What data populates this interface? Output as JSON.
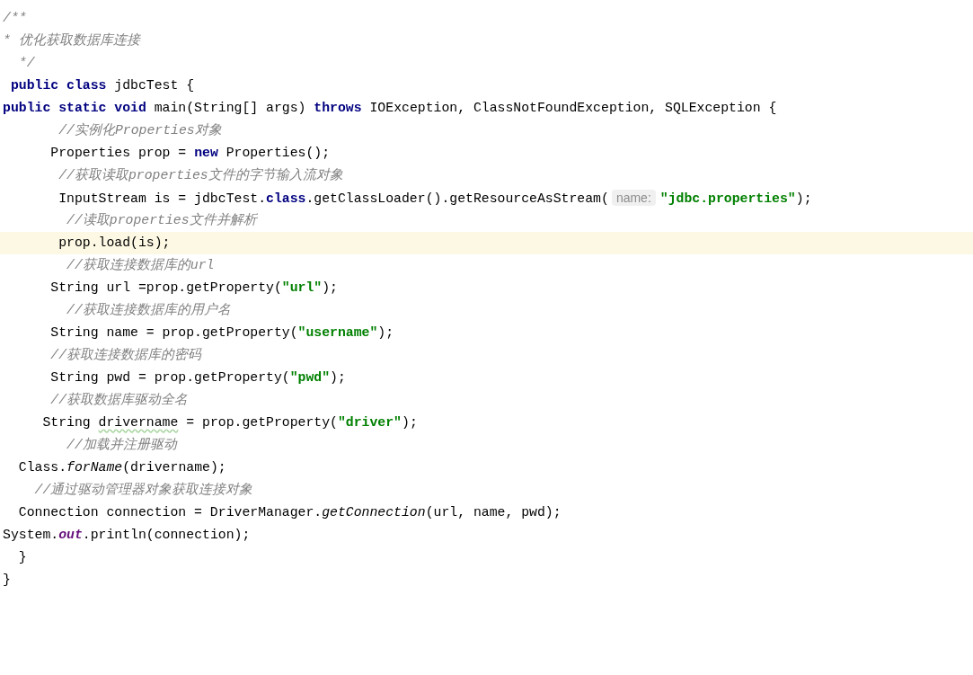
{
  "editor": {
    "lines": [
      {
        "current": false,
        "tokens": [
          {
            "kind": "comment",
            "text": "/**"
          }
        ]
      },
      {
        "current": false,
        "tokens": [
          {
            "kind": "comment",
            "text": "* 优化获取数据库连接"
          }
        ]
      },
      {
        "current": false,
        "tokens": [
          {
            "kind": "comment",
            "text": "  */"
          }
        ]
      },
      {
        "current": false,
        "tokens": [
          {
            "kind": "keyword",
            "text": " public class"
          },
          {
            "kind": "plain",
            "text": " jdbcTest {"
          }
        ]
      },
      {
        "current": false,
        "tokens": [
          {
            "kind": "keyword",
            "text": "public static void"
          },
          {
            "kind": "plain",
            "text": " main(String[] args) "
          },
          {
            "kind": "keyword",
            "text": "throws"
          },
          {
            "kind": "plain",
            "text": " IOException, ClassNotFoundException, SQLException {"
          }
        ]
      },
      {
        "current": false,
        "tokens": [
          {
            "kind": "comment",
            "text": "       //实例化Properties对象"
          }
        ]
      },
      {
        "current": false,
        "tokens": [
          {
            "kind": "plain",
            "text": "      Properties prop = "
          },
          {
            "kind": "keyword",
            "text": "new"
          },
          {
            "kind": "plain",
            "text": " Properties();"
          }
        ]
      },
      {
        "current": false,
        "tokens": [
          {
            "kind": "comment",
            "text": "       //获取读取properties文件的字节输入流对象"
          }
        ]
      },
      {
        "current": false,
        "tokens": [
          {
            "kind": "plain",
            "text": "       InputStream is = jdbcTest."
          },
          {
            "kind": "keyword",
            "text": "class"
          },
          {
            "kind": "plain",
            "text": ".getClassLoader().getResourceAsStream("
          },
          {
            "kind": "hint",
            "text": "name:"
          },
          {
            "kind": "string",
            "text": "\"jdbc.properties\""
          },
          {
            "kind": "plain",
            "text": ");"
          }
        ]
      },
      {
        "current": false,
        "tokens": [
          {
            "kind": "comment",
            "text": "        //读取properties文件并解析"
          }
        ]
      },
      {
        "current": true,
        "tokens": [
          {
            "kind": "plain",
            "text": "       prop.load(is);"
          }
        ]
      },
      {
        "current": false,
        "tokens": [
          {
            "kind": "comment",
            "text": "        //获取连接数据库的url"
          }
        ]
      },
      {
        "current": false,
        "tokens": [
          {
            "kind": "plain",
            "text": "      String url =prop.getProperty("
          },
          {
            "kind": "string",
            "text": "\"url\""
          },
          {
            "kind": "plain",
            "text": ");"
          }
        ]
      },
      {
        "current": false,
        "tokens": [
          {
            "kind": "comment",
            "text": "        //获取连接数据库的用户名"
          }
        ]
      },
      {
        "current": false,
        "tokens": [
          {
            "kind": "plain",
            "text": "      String name = prop.getProperty("
          },
          {
            "kind": "string",
            "text": "\"username\""
          },
          {
            "kind": "plain",
            "text": ");"
          }
        ]
      },
      {
        "current": false,
        "tokens": [
          {
            "kind": "comment",
            "text": "      //获取连接数据库的密码"
          }
        ]
      },
      {
        "current": false,
        "tokens": [
          {
            "kind": "plain",
            "text": "      String pwd = prop.getProperty("
          },
          {
            "kind": "string",
            "text": "\"pwd\""
          },
          {
            "kind": "plain",
            "text": ");"
          }
        ]
      },
      {
        "current": false,
        "tokens": [
          {
            "kind": "comment",
            "text": "      //获取数据库驱动全名"
          }
        ]
      },
      {
        "current": false,
        "tokens": [
          {
            "kind": "plain",
            "text": "     String "
          },
          {
            "kind": "warning",
            "text": "drivername"
          },
          {
            "kind": "plain",
            "text": " = prop.getProperty("
          },
          {
            "kind": "string",
            "text": "\"driver\""
          },
          {
            "kind": "plain",
            "text": ");"
          }
        ]
      },
      {
        "current": false,
        "tokens": [
          {
            "kind": "comment",
            "text": "        //加载并注册驱动"
          }
        ]
      },
      {
        "current": false,
        "tokens": [
          {
            "kind": "plain",
            "text": "  Class."
          },
          {
            "kind": "static",
            "text": "forName"
          },
          {
            "kind": "plain",
            "text": "(drivername);"
          }
        ]
      },
      {
        "current": false,
        "tokens": [
          {
            "kind": "comment",
            "text": "    //通过驱动管理器对象获取连接对象"
          }
        ]
      },
      {
        "current": false,
        "tokens": [
          {
            "kind": "plain",
            "text": "  Connection connection = DriverManager."
          },
          {
            "kind": "static",
            "text": "getConnection"
          },
          {
            "kind": "plain",
            "text": "(url, name, pwd);"
          }
        ]
      },
      {
        "current": false,
        "tokens": [
          {
            "kind": "plain",
            "text": "System."
          },
          {
            "kind": "field",
            "text": "out"
          },
          {
            "kind": "plain",
            "text": ".println(connection);"
          }
        ]
      },
      {
        "current": false,
        "tokens": [
          {
            "kind": "plain",
            "text": "  }"
          }
        ]
      },
      {
        "current": false,
        "tokens": [
          {
            "kind": "plain",
            "text": "}"
          }
        ]
      }
    ]
  }
}
